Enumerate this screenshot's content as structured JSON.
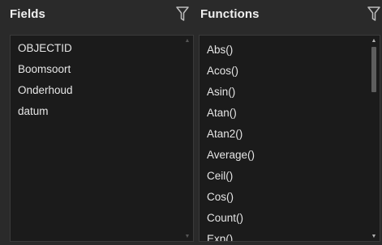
{
  "fields_panel": {
    "title": "Fields",
    "filter_icon": "filter-icon",
    "items": [
      "OBJECTID",
      "Boomsoort",
      "Onderhoud",
      "datum"
    ]
  },
  "functions_panel": {
    "title": "Functions",
    "filter_icon": "filter-icon",
    "items": [
      "Abs()",
      "Acos()",
      "Asin()",
      "Atan()",
      "Atan2()",
      "Average()",
      "Ceil()",
      "Cos()",
      "Count()",
      "Exp()"
    ]
  },
  "colors": {
    "background": "#2a2a2a",
    "list_background": "#1b1b1b",
    "text": "#e6e6e6",
    "scroll_thumb": "#5e5e5e"
  }
}
